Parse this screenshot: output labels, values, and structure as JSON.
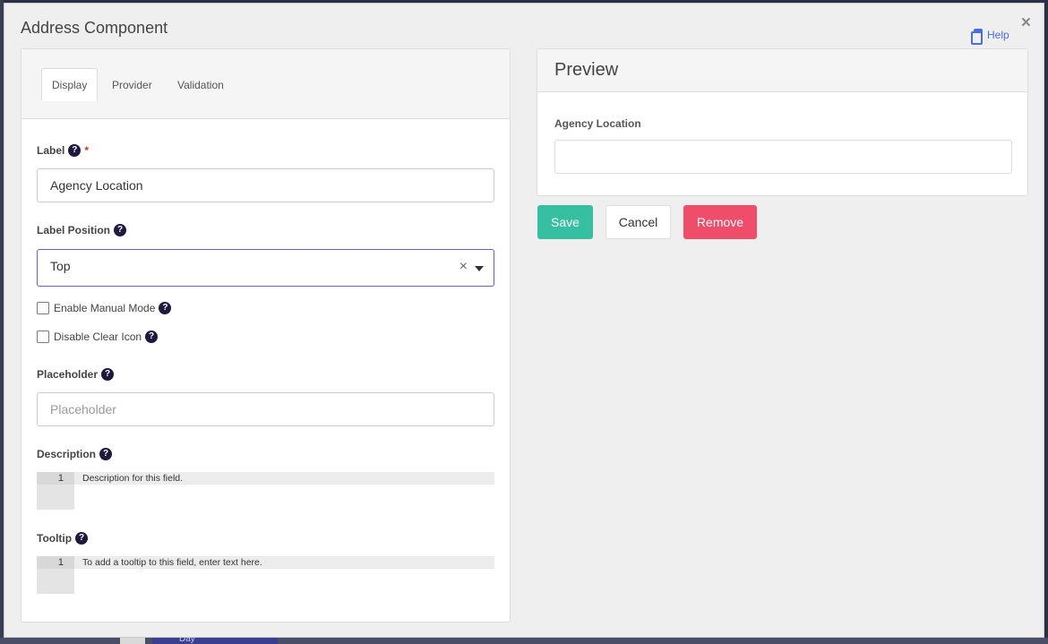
{
  "modal": {
    "title": "Address Component",
    "help_label": "Help",
    "close_glyph": "×"
  },
  "tabs": [
    {
      "label": "Display",
      "active": true
    },
    {
      "label": "Provider",
      "active": false
    },
    {
      "label": "Validation",
      "active": false
    }
  ],
  "form": {
    "label": {
      "title": "Label",
      "required_mark": "*",
      "value": "Agency Location"
    },
    "label_position": {
      "title": "Label Position",
      "value": "Top",
      "clear_glyph": "×"
    },
    "enable_manual_mode": {
      "title": "Enable Manual Mode",
      "checked": false
    },
    "disable_clear_icon": {
      "title": "Disable Clear Icon",
      "checked": false
    },
    "placeholder": {
      "title": "Placeholder",
      "value": "",
      "placeholder": "Placeholder"
    },
    "description": {
      "title": "Description",
      "line_number": "1",
      "text": "Description for this field."
    },
    "tooltip": {
      "title": "Tooltip",
      "line_number": "1",
      "text": "To add a tooltip to this field, enter text here."
    }
  },
  "help_glyph": "?",
  "preview": {
    "title": "Preview",
    "field_label": "Agency Location",
    "field_value": ""
  },
  "buttons": {
    "save": "Save",
    "cancel": "Cancel",
    "remove": "Remove"
  },
  "background": {
    "chip_text": "Day"
  }
}
